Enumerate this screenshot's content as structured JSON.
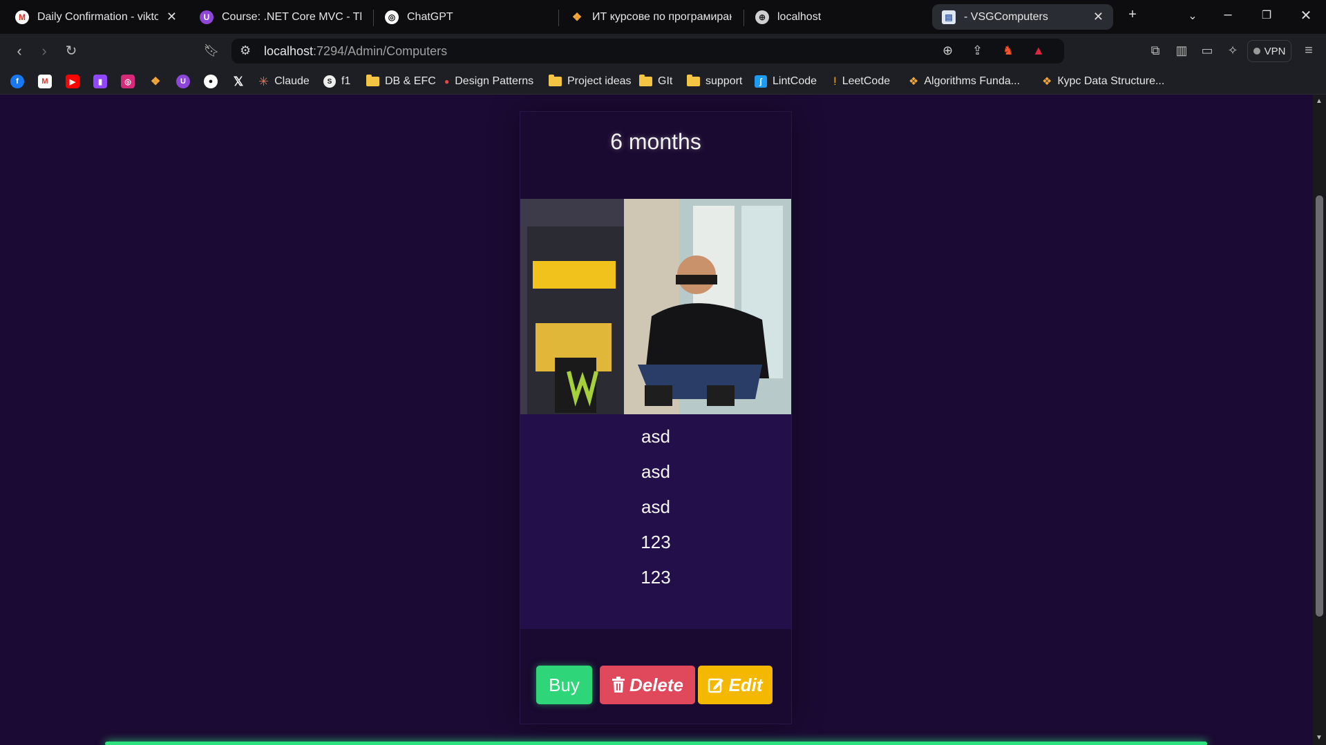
{
  "tabs": [
    {
      "title": "Daily Confirmation - viktor",
      "icon": "gmail-icon"
    },
    {
      "title": "Course: .NET Core MVC - The C",
      "icon": "udemy-icon"
    },
    {
      "title": "ChatGPT",
      "icon": "chatgpt-icon"
    },
    {
      "title": "ИТ курсове по програмиране",
      "icon": "softuni-icon"
    },
    {
      "title": "localhost",
      "icon": "globe-icon"
    },
    {
      "title": "- VSGComputers",
      "icon": "page-icon"
    }
  ],
  "address": {
    "host": "localhost",
    "path": ":7294/Admin/Computers"
  },
  "vpn_label": "VPN",
  "bookmarks": [
    {
      "label": "Claude"
    },
    {
      "label": "f1"
    },
    {
      "label": "DB & EFC"
    },
    {
      "label": "Design Patterns"
    },
    {
      "label": "Project ideas"
    },
    {
      "label": "GIt"
    },
    {
      "label": "support"
    },
    {
      "label": "LintCode"
    },
    {
      "label": "LeetCode"
    },
    {
      "label": "Algorithms Funda..."
    },
    {
      "label": "Курс Data Structure..."
    }
  ],
  "card": {
    "title": "6 months",
    "specs": [
      "asd",
      "asd",
      "asd",
      "123",
      "123"
    ],
    "buy_label": "Buy",
    "delete_label": "Delete",
    "edit_label": "Edit"
  },
  "colors": {
    "page_bg": "#1b0a33",
    "specs_bg": "#230f4a",
    "buy": "#2fd679",
    "delete": "#e0485c",
    "edit": "#f5b800"
  }
}
